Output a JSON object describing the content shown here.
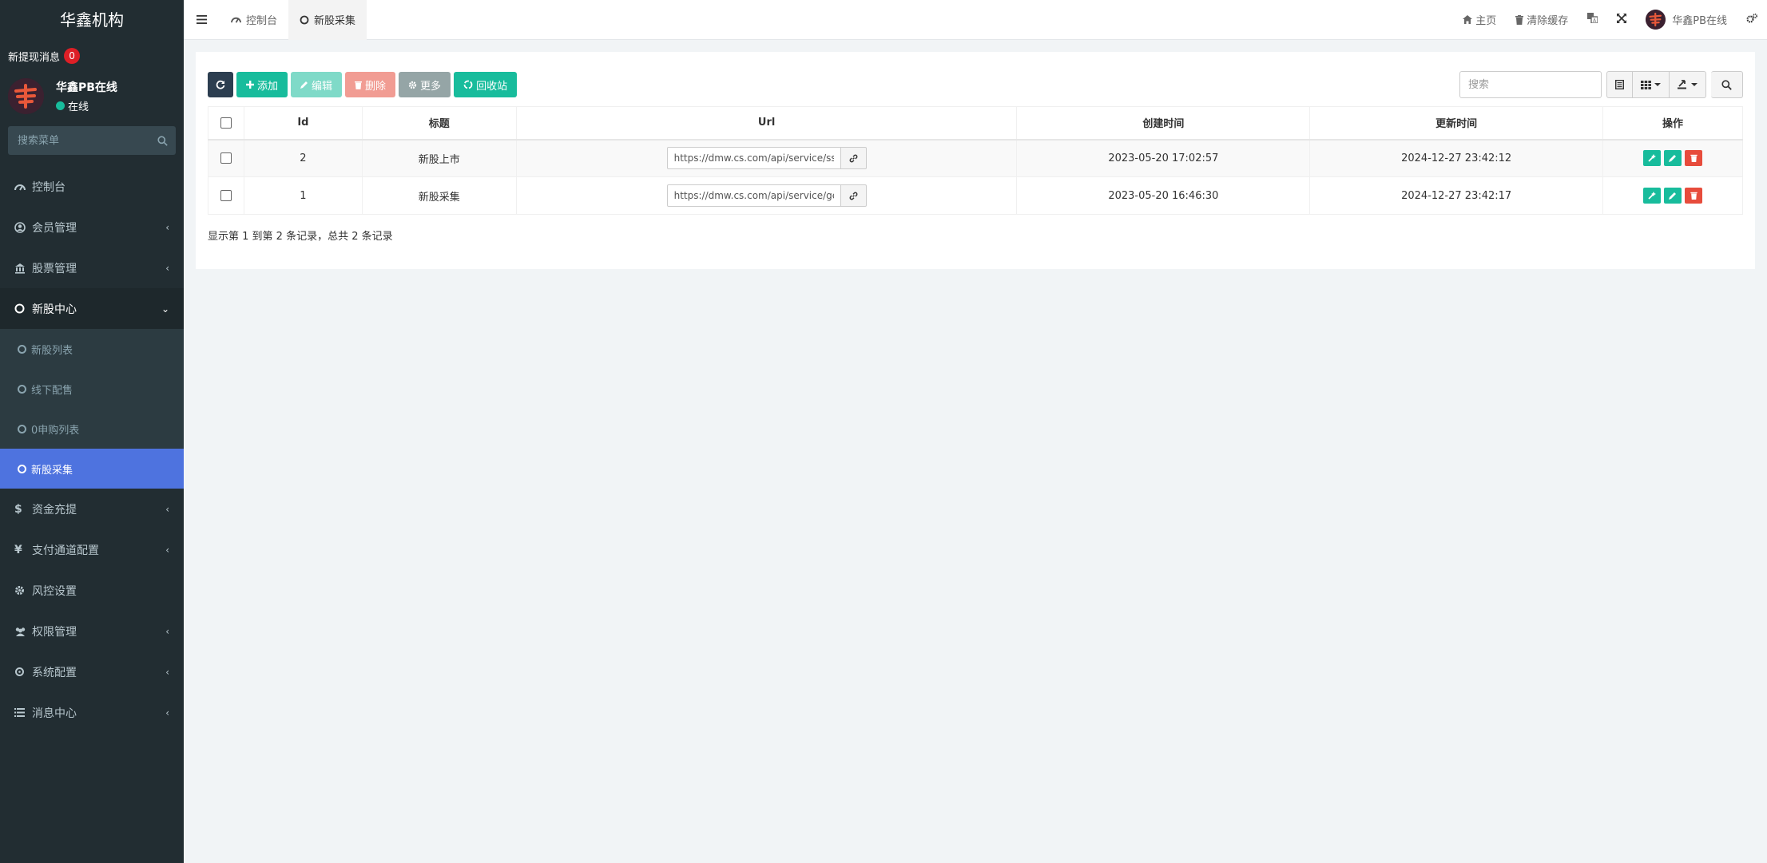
{
  "sidebar": {
    "brand": "华鑫机构",
    "notice_label": "新提现消息",
    "notice_count": "0",
    "user_name": "华鑫PB在线",
    "user_status": "在线",
    "search_placeholder": "搜索菜单",
    "menu": [
      {
        "label": "控制台",
        "icon": "dashboard-icon"
      },
      {
        "label": "会员管理",
        "icon": "user-circle-icon"
      },
      {
        "label": "股票管理",
        "icon": "bank-icon"
      },
      {
        "label": "新股中心",
        "icon": "circle-icon"
      },
      {
        "label": "资金充提",
        "icon": "dollar-icon"
      },
      {
        "label": "支付通道配置",
        "icon": "yen-icon"
      },
      {
        "label": "风控设置",
        "icon": "gear-icon"
      },
      {
        "label": "权限管理",
        "icon": "users-icon"
      },
      {
        "label": "系统配置",
        "icon": "cog-icon"
      },
      {
        "label": "消息中心",
        "icon": "list-icon"
      }
    ],
    "submenu": [
      {
        "label": "新股列表"
      },
      {
        "label": "线下配售"
      },
      {
        "label": "0申购列表"
      },
      {
        "label": "新股采集"
      }
    ]
  },
  "topbar": {
    "tabs": [
      {
        "label": "控制台"
      },
      {
        "label": "新股采集"
      }
    ],
    "home_label": "主页",
    "clear_cache_label": "清除缓存",
    "user_name": "华鑫PB在线"
  },
  "toolbar": {
    "add_label": "添加",
    "edit_label": "编辑",
    "delete_label": "删除",
    "more_label": "更多",
    "recycle_label": "回收站",
    "search_placeholder": "搜索"
  },
  "table": {
    "columns": [
      "Id",
      "标题",
      "Url",
      "创建时间",
      "更新时间",
      "操作"
    ],
    "rows": [
      {
        "id": "2",
        "title": "新股上市",
        "url": "https://dmw.cs.com/api/service/ssgp",
        "created": "2023-05-20 17:02:57",
        "updated": "2024-12-27 23:42:12"
      },
      {
        "id": "1",
        "title": "新股采集",
        "url": "https://dmw.cs.com/api/service/getxi",
        "created": "2023-05-20 16:46:30",
        "updated": "2024-12-27 23:42:17"
      }
    ]
  },
  "pager": {
    "info": "显示第 1 到第 2 条记录，总共 2 条记录"
  },
  "colors": {
    "sidebar_bg": "#222d32",
    "active_item": "#4e73df",
    "success": "#18bc9c",
    "danger": "#e74c3c",
    "badge": "#dd1f26"
  }
}
